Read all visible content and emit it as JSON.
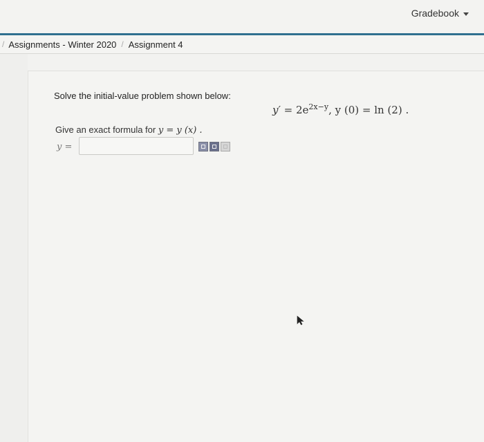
{
  "header": {
    "gradebook_label": "Gradebook"
  },
  "breadcrumb": {
    "items": [
      "Assignments - Winter 2020",
      "Assignment 4"
    ]
  },
  "problem": {
    "prompt": "Solve the initial-value problem shown below:",
    "equation": {
      "lhs": "y′",
      "eq": " = 2e",
      "exponent": "2x−y",
      "cond_sep": ",   ",
      "cond": "y (0) = ln (2)",
      "end": " ."
    },
    "instruction": "Give an exact formula for ",
    "instruction_math": "y = y (x) .",
    "answer_label": "y =",
    "answer_value": "",
    "answer_placeholder": ""
  },
  "icons": [
    "preview-icon",
    "syntax-icon",
    "help-icon",
    "cursor-icon"
  ],
  "colors": {
    "accent_rule": "#2f6f8f",
    "background": "#f1f1ef"
  }
}
